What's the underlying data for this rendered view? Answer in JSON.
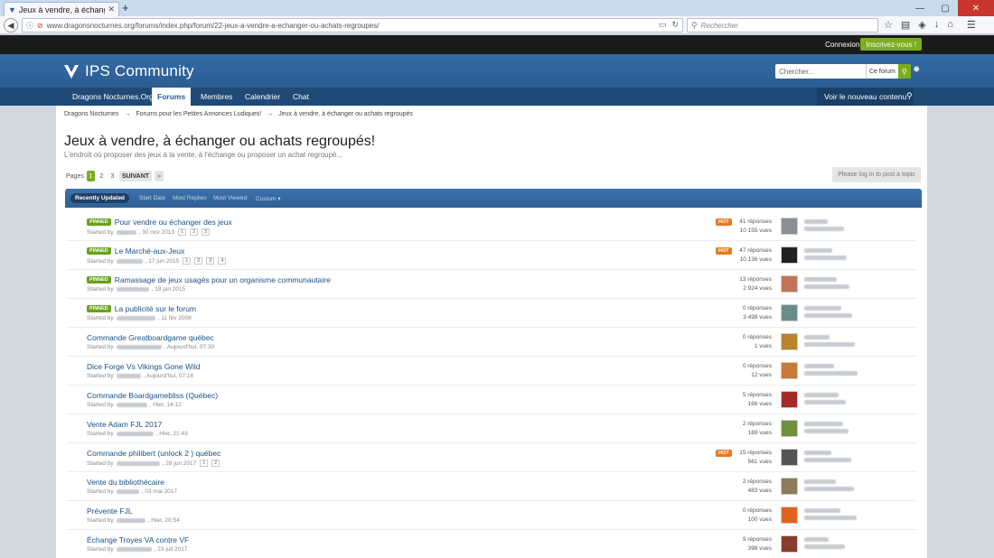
{
  "browser": {
    "tab_title": "Jeux à vendre, à échanger ou...",
    "url": "www.dragonsnocturnes.org/forums/index.php/forum/22-jeux-a-vendre-a-echanger-ou-achats-regroupes/",
    "search_placeholder": "Rechercher"
  },
  "userbar": {
    "login": "Connexion »",
    "register": "Inscrivez-vous !"
  },
  "header": {
    "logo_text": "IPS Community",
    "search_placeholder": "Chercher...",
    "search_scope": "Ce forum"
  },
  "nav": {
    "items": [
      "Dragons Nocturnes.Org",
      "Forums",
      "Membres",
      "Calendrier",
      "Chat"
    ],
    "active": "Forums",
    "new_content": "Voir le nouveau contenu"
  },
  "breadcrumb": [
    "Dragons Nocturnes",
    "→",
    "Forums pour les Petites Annonces Ludiques!",
    "→",
    "Jeux à vendre, à échanger ou achats regroupés"
  ],
  "page": {
    "title": "Jeux à vendre, à échanger ou achats regroupés!",
    "description": "L'endroit où proposer des jeux à la vente, à l'échange ou proposer un achat regroupé..."
  },
  "pagination": {
    "label": "Pages",
    "pages": [
      "1",
      "2",
      "3"
    ],
    "next": "SUIVANT",
    "last": "»"
  },
  "post_button": "Please log in to post a topic",
  "filters": [
    "Recently Updated",
    "Start Date",
    "Most Replies",
    "Most Viewed",
    "Custom ▾"
  ],
  "topics": [
    {
      "title": "Pour vendre ou échanger des jeux",
      "pinned": true,
      "hot": true,
      "started_prefix": "Started by",
      "date": ", 30 nov 2013",
      "pages": [
        "1",
        "2",
        "3"
      ],
      "replies": "41 réponses",
      "views": "10 155 vues",
      "avatar_color": "#8a8f96"
    },
    {
      "title": "Le Marché-aux-Jeux",
      "pinned": true,
      "hot": true,
      "started_prefix": "Started by",
      "date": ", 17 jun 2015",
      "pages": [
        "1",
        "2",
        "3",
        "4"
      ],
      "replies": "47 réponses",
      "views": "10 136 vues",
      "avatar_color": "#222222"
    },
    {
      "title": "Ramassage de jeux usagés pour un organisme communautaire",
      "pinned": true,
      "hot": false,
      "started_prefix": "Started by",
      "date": ", 18 jan 2015",
      "pages": [],
      "replies": "13 réponses",
      "views": "2 924 vues",
      "avatar_color": "#c4735a"
    },
    {
      "title": "La publicité sur le forum",
      "pinned": true,
      "hot": false,
      "started_prefix": "Started by",
      "date": ", 11 fév 2008",
      "pages": [],
      "replies": "0 réponses",
      "views": "3 498 vues",
      "avatar_color": "#6b8c8a"
    },
    {
      "title": "Commande Greatboardgame québec",
      "pinned": false,
      "hot": false,
      "started_prefix": "Started by",
      "date": ", Aujourd'hui, 07:30",
      "pages": [],
      "replies": "0 réponses",
      "views": "1 vues",
      "avatar_color": "#b8842c"
    },
    {
      "title": "Dice Forge Vs Vikings Gone Wild",
      "pinned": false,
      "hot": false,
      "started_prefix": "Started by",
      "date": ", Aujourd'hui, 07:16",
      "pages": [],
      "replies": "0 réponses",
      "views": "12 vues",
      "avatar_color": "#c97a3a"
    },
    {
      "title": "Commande Boardgamebliss (Québec)",
      "pinned": false,
      "hot": false,
      "started_prefix": "Started by",
      "date": ", Hier, 14:12",
      "pages": [],
      "replies": "5 réponses",
      "views": "166 vues",
      "avatar_color": "#a52a2a"
    },
    {
      "title": "Vente Adam FJL 2017",
      "pinned": false,
      "hot": false,
      "started_prefix": "Started by",
      "date": ", Hier, 21:43",
      "pages": [],
      "replies": "2 réponses",
      "views": "169 vues",
      "avatar_color": "#6f8f3a"
    },
    {
      "title": "Commande philibert (unlock 2 ) québec",
      "pinned": false,
      "hot": true,
      "started_prefix": "Started by",
      "date": ", 28 jun 2017",
      "pages": [
        "1",
        "2"
      ],
      "replies": "15 réponses",
      "views": "561 vues",
      "avatar_color": "#555555"
    },
    {
      "title": "Vente du bibliothécaire",
      "pinned": false,
      "hot": false,
      "started_prefix": "Started by",
      "date": ", 03 mai 2017",
      "pages": [],
      "replies": "2 réponses",
      "views": "483 vues",
      "avatar_color": "#8c7a5a"
    },
    {
      "title": "Prévente FJL",
      "pinned": false,
      "hot": false,
      "started_prefix": "Started by",
      "date": ", Hier, 20:54",
      "pages": [],
      "replies": "0 réponses",
      "views": "100 vues",
      "avatar_color": "#e0621e"
    },
    {
      "title": "Échange Troyes VA contre VF",
      "pinned": false,
      "hot": false,
      "started_prefix": "Started by",
      "date": ", 23 juil 2017",
      "pages": [],
      "replies": "9 réponses",
      "views": "398 vues",
      "avatar_color": "#8a3a2a"
    }
  ],
  "labels": {
    "pinned": "PINNED",
    "hot": "HOT"
  }
}
